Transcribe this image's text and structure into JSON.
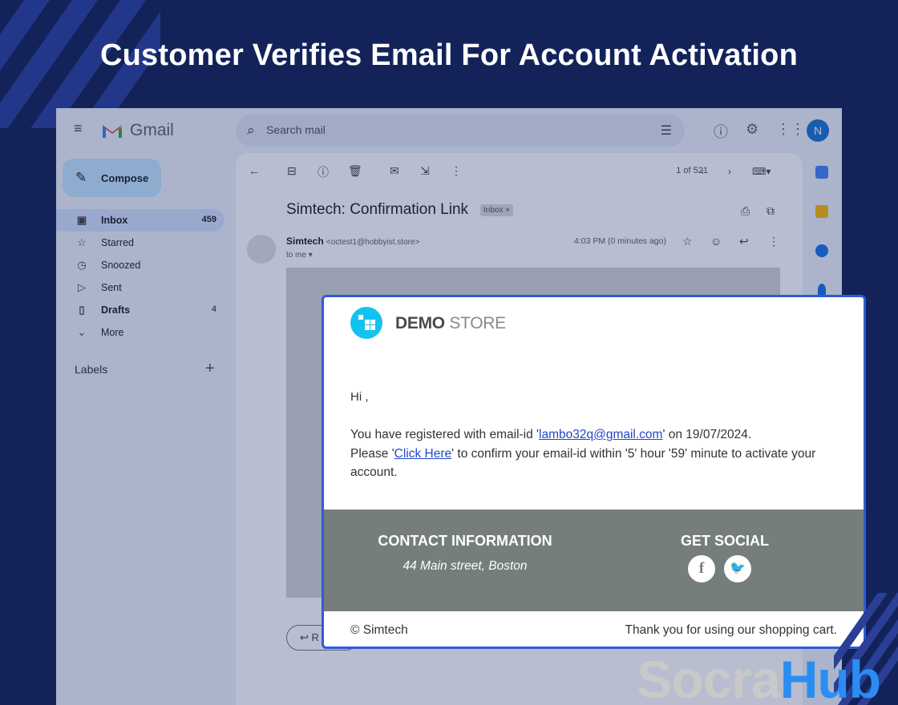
{
  "headline": "Customer Verifies Email For Account Activation",
  "gmail": {
    "brand": "Gmail",
    "search_placeholder": "Search mail",
    "avatar_letter": "N",
    "compose_label": "Compose",
    "nav": [
      {
        "icon": "inbox-icon",
        "label": "Inbox",
        "count": "459"
      },
      {
        "icon": "star-icon",
        "label": "Starred",
        "count": ""
      },
      {
        "icon": "clock-icon",
        "label": "Snoozed",
        "count": ""
      },
      {
        "icon": "send-icon",
        "label": "Sent",
        "count": ""
      },
      {
        "icon": "file-icon",
        "label": "Drafts",
        "count": "4"
      },
      {
        "icon": "chevron-down-icon",
        "label": "More",
        "count": ""
      }
    ],
    "labels_title": "Labels",
    "pager": "1 of 521",
    "subject": "Simtech: Confirmation Link",
    "inbox_tag": "Inbox ×",
    "sender_name": "Simtech",
    "sender_email": "<octest1@hobbyist.store>",
    "to_me": "to me ▾",
    "time": "4:03 PM (0 minutes ago)",
    "reply_label": "R"
  },
  "email": {
    "store_bold": "DEMO",
    "store_light": "STORE",
    "greeting": "Hi ,",
    "line1_pre": "You have registered with email-id '",
    "line1_link": "lambo32q@gmail.com",
    "line1_post": "' on 19/07/2024.",
    "line2_pre": "Please '",
    "line2_link": "Click Here",
    "line2_post": "' to confirm your email-id within '5' hour '59' minute to activate your account.",
    "contact_heading": "CONTACT INFORMATION",
    "contact_address": "44 Main street, Boston",
    "social_heading": "GET SOCIAL",
    "facebook_glyph": "f",
    "twitter_glyph": "🐦",
    "copyright": "© Simtech",
    "thanks": "Thank you for using our shopping cart."
  },
  "brand": {
    "part1": "Socra",
    "part2": "Hub"
  },
  "colors": {
    "background": "#13235a",
    "card_border": "#2f5bd8",
    "link": "#2347c9",
    "footer_gray": "#767d7d",
    "logo": "#13c3ef",
    "brand_blue": "#2b8df2"
  }
}
